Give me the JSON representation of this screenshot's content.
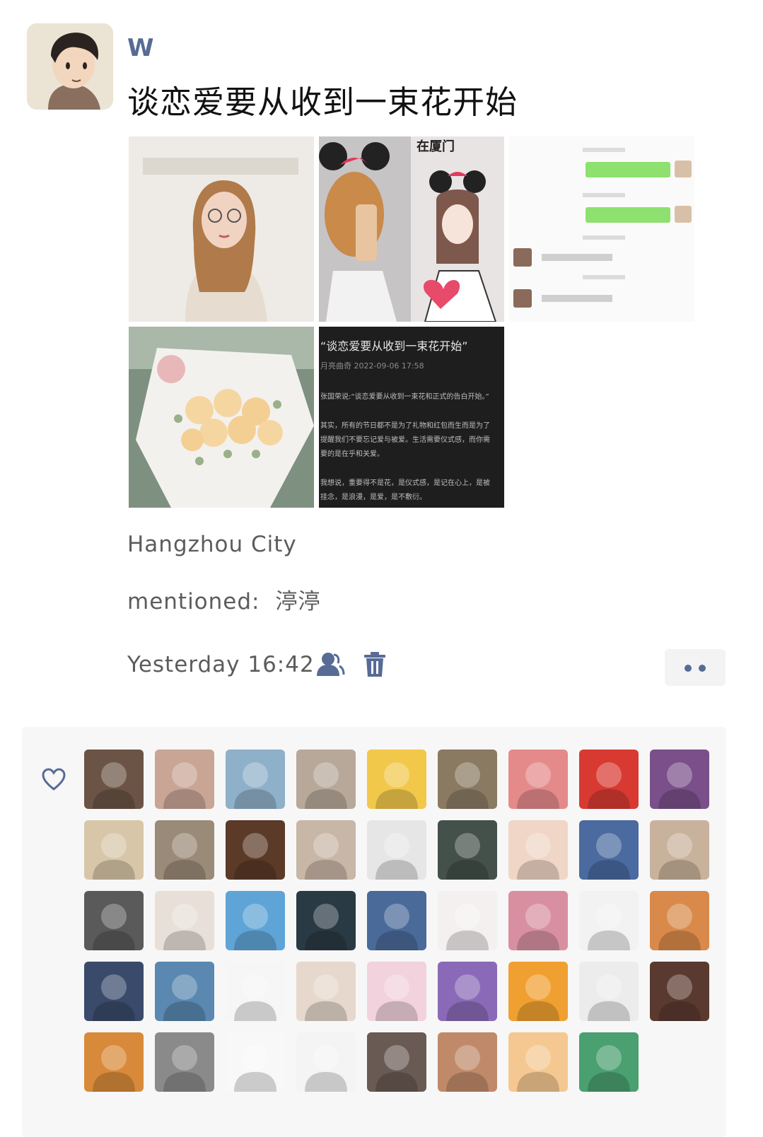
{
  "post": {
    "username": "W",
    "text": "谈恋爱要从收到一束花开始",
    "location": "Hangzhou City",
    "mentioned_label": "mentioned:",
    "mentioned_name": "渟渟",
    "timestamp": "Yesterday 16:42"
  },
  "article_image": {
    "title": "“谈恋爱要从收到一束花开始”",
    "meta": "月亮曲奇   2022-09-06 17:58",
    "lines": [
      "张国荣说:“谈恋爱要从收到一束花和正式的告白开始。”",
      "其实，所有的节日都不是为了礼物和红包而生而是为了",
      "提醒我们不要忘记爱与被爱。生活需要仪式感，而你需",
      "要的是在乎和关爱。",
      "我想说，重要得不是花，是仪式感，是记在心上，是被",
      "挂念，是浪漫，是爱，是不敷衍。"
    ]
  },
  "likers_count": 44,
  "likers_colors": [
    "#6b5446",
    "#c9a595",
    "#8fb0c9",
    "#b8a89a",
    "#f2c84b",
    "#8a7a62",
    "#e58a8a",
    "#d83a32",
    "#7a4f8a",
    "#d7c6a8",
    "#9a8a78",
    "#5b3a28",
    "#c8b6a6",
    "#e6e6e6",
    "#44504a",
    "#f0d6c6",
    "#4a6aa0",
    "#c9b29c",
    "#5a5a5a",
    "#e8e0d8",
    "#5fa4d6",
    "#2a3a44",
    "#4a6a9a",
    "#f4f0f0",
    "#d890a0",
    "#f2f2f2",
    "#d98a4a",
    "#3a4a6a",
    "#5a88b0",
    "#f6f6f6",
    "#e6d8cc",
    "#f2d2dc",
    "#8a6ab8",
    "#f0a030",
    "#ececec",
    "#5a3a30",
    "#d88a3a",
    "#8a8a8a",
    "#f8f8f8",
    "#f4f4f4",
    "#6a5a54",
    "#c08a6a",
    "#f4c890",
    "#4aa070"
  ],
  "colors": {
    "link": "#576b95",
    "meta_text": "#5c5c5c",
    "panel_bg": "#f7f7f7"
  },
  "icons": [
    "avatar",
    "visibility-icon",
    "delete-icon",
    "more-icon",
    "heart-icon"
  ]
}
